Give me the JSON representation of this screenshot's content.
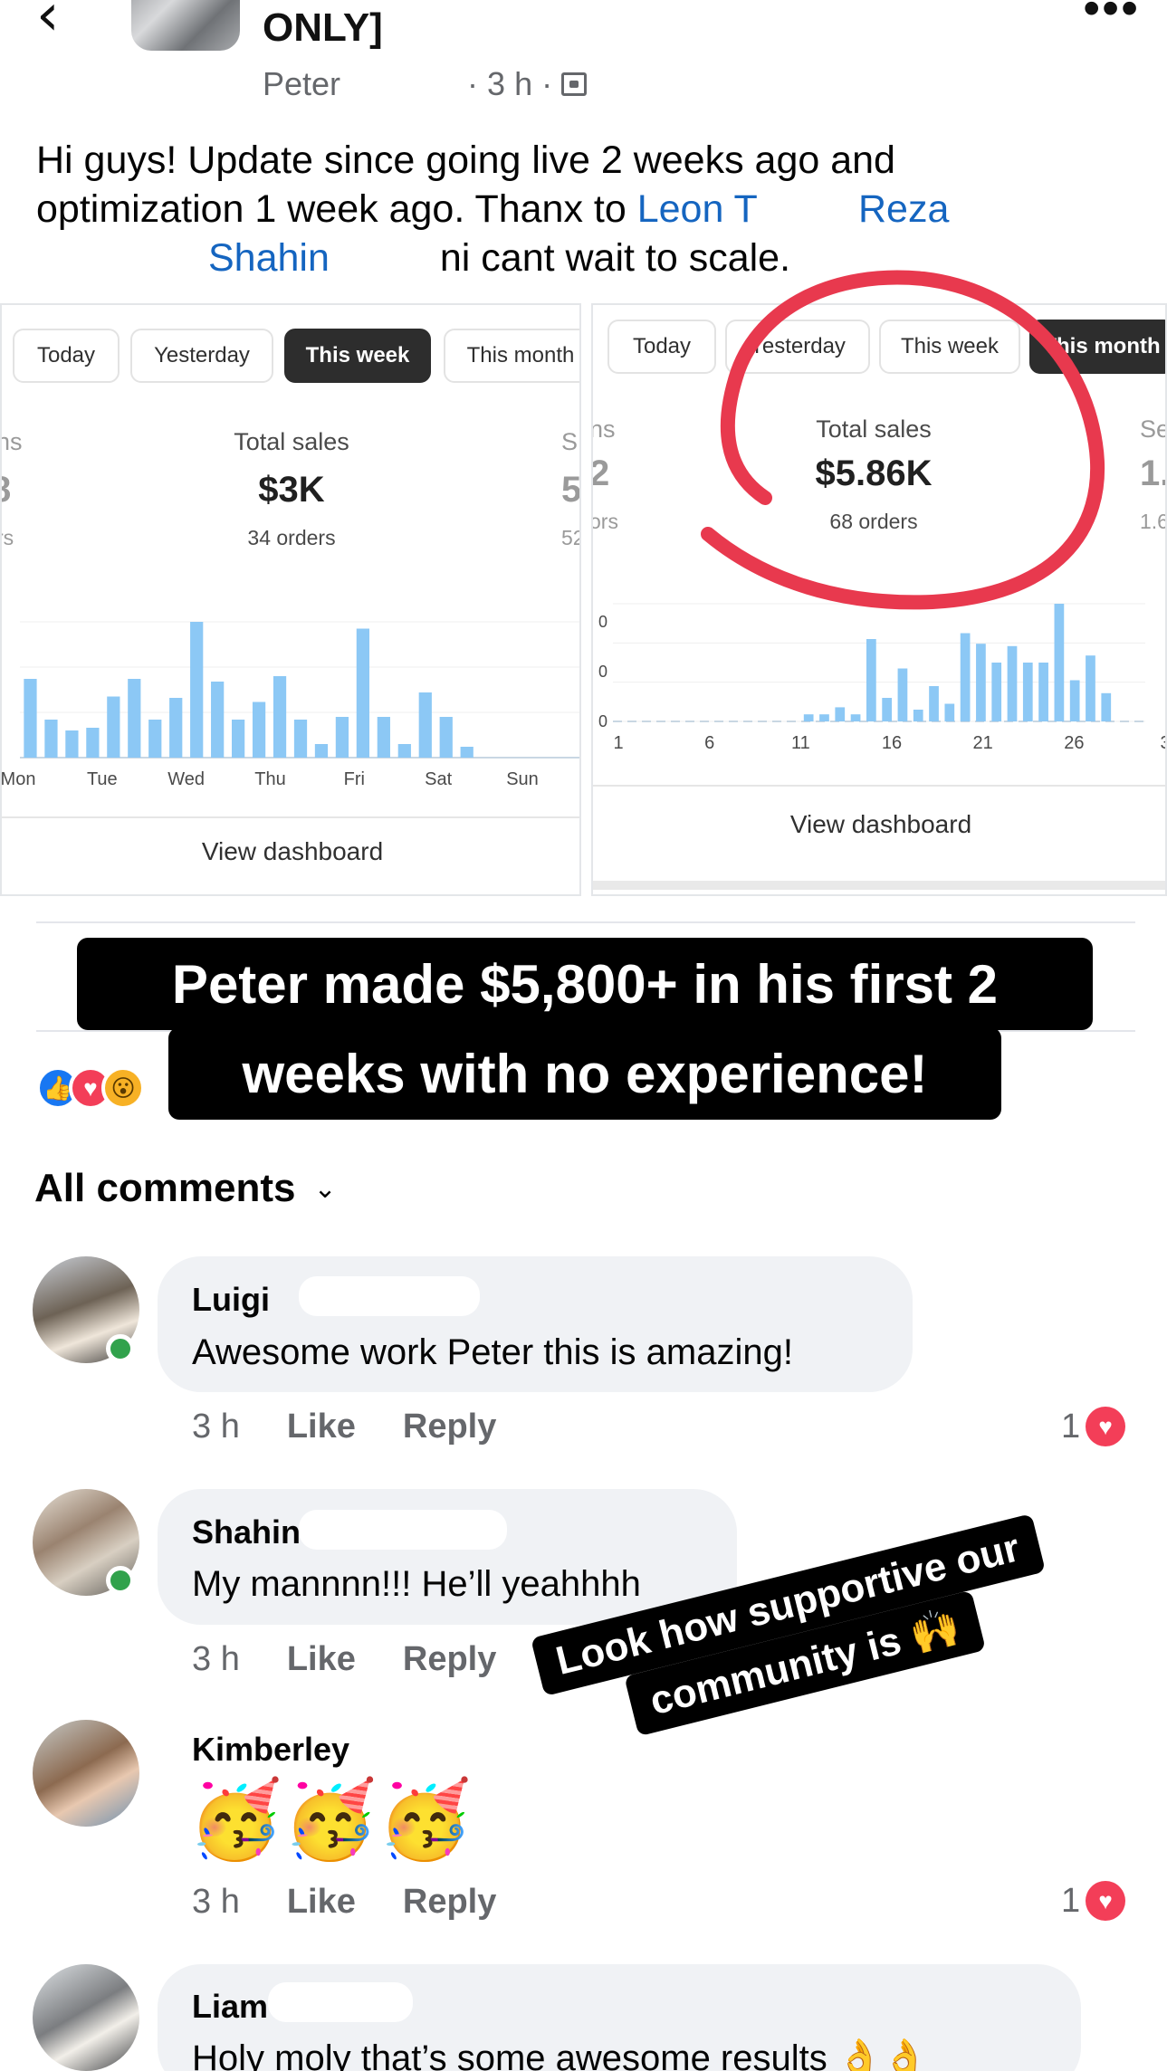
{
  "header": {
    "group_name": "ONLY]",
    "author": "Peter",
    "time": "3 h"
  },
  "post": {
    "line1": "Hi guys! Update since going live 2 weeks ago and",
    "line2a": "optimization 1 week ago. Thanx to ",
    "line2_leon": "Leon T",
    "line2_reza": "Reza",
    "line3_shahin": "Shahin",
    "line3b": "ni cant wait to scale."
  },
  "dashboard_left": {
    "tabs": [
      "Today",
      "Yesterday",
      "This week",
      "This month"
    ],
    "active_tab": "This week",
    "total_sales_label": "Total sales",
    "total_sales_value": "$3K",
    "orders": "34 orders",
    "side_label": "S",
    "side_value": "5",
    "side_sub": "52",
    "left_label": "ns",
    "left_value": "8",
    "left_sub": "rs",
    "view_dashboard": "View dashboard"
  },
  "dashboard_right": {
    "tabs": [
      "Today",
      "Yesterday",
      "This week",
      "This month"
    ],
    "active_tab": "This month",
    "total_sales_label": "Total sales",
    "total_sales_value": "$5.86K",
    "orders": "68 orders",
    "side_label": "Se",
    "side_value": "1.",
    "side_sub": "1.6",
    "left_label": "ns",
    "left_value": "2",
    "left_sub": "ors",
    "view_dashboard": "View dashboard"
  },
  "chart_data": [
    {
      "type": "bar",
      "title": "",
      "categories": [
        "Mon",
        "Tue",
        "Wed",
        "Thu",
        "Fri",
        "Sat",
        "Sun"
      ],
      "x_tick_labels": [
        "Mon",
        "Tue",
        "Wed",
        "Thu",
        "Fri",
        "Sat",
        "Sun"
      ],
      "series": [
        {
          "values": [
            58,
            28,
            20,
            22,
            45,
            58,
            28,
            44,
            100,
            56,
            28,
            41,
            60,
            28,
            10,
            30,
            95,
            30,
            10,
            48,
            30,
            8,
            0,
            0,
            0,
            0,
            0
          ]
        }
      ],
      "color": "#8cc8f5"
    },
    {
      "type": "bar",
      "title": "",
      "x_tick_labels": [
        "1",
        "6",
        "11",
        "16",
        "21",
        "26",
        "3"
      ],
      "y_tick_labels": [
        "0",
        "0",
        "0"
      ],
      "series": [
        {
          "values": [
            0,
            0,
            0,
            0,
            0,
            0,
            0,
            0,
            0,
            0,
            0,
            0,
            6,
            6,
            12,
            6,
            70,
            20,
            45,
            10,
            30,
            15,
            75,
            66,
            50,
            64,
            50,
            50,
            100,
            35,
            56,
            24,
            0,
            0
          ]
        }
      ],
      "color": "#8cc8f5"
    }
  ],
  "caption_main": {
    "line1": "Peter made $5,800+ in his first 2",
    "line2": "weeks with no experience!"
  },
  "all_comments_label": "All comments",
  "comments": [
    {
      "name": "Luigi",
      "text": "Awesome work Peter this is amazing!",
      "time": "3 h",
      "like": "Like",
      "reply": "Reply",
      "likes": "1"
    },
    {
      "name": "Shahin",
      "text": "My mannnn!!! He’ll yeahhhh",
      "time": "3 h",
      "like": "Like",
      "reply": "Reply",
      "likes": ""
    },
    {
      "name": "Kimberley",
      "text": "🥳🥳🥳",
      "time": "3 h",
      "like": "Like",
      "reply": "Reply",
      "likes": "1"
    },
    {
      "name": "Liam",
      "text": "Holy moly that’s some awesome results 👌👌",
      "time": "",
      "like": "",
      "reply": "",
      "likes": ""
    }
  ],
  "caption_side": {
    "line1": "Look how supportive our",
    "line2": "community is 🙌"
  },
  "colors": {
    "link": "#1565c0",
    "bar": "#8cc8f5",
    "circle": "#e8394e",
    "online": "#31a24c"
  }
}
